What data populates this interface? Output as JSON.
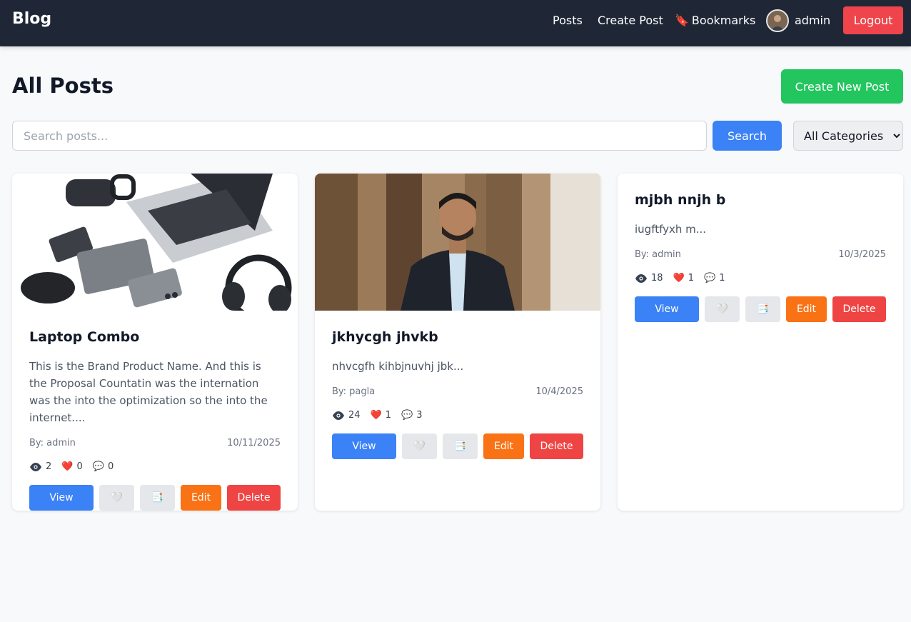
{
  "navbar": {
    "brand": "Blog",
    "links": {
      "posts": "Posts",
      "create_post": "Create Post",
      "bookmarks": "Bookmarks"
    },
    "bookmark_icon": "🔖",
    "user": {
      "name": "admin"
    },
    "logout_label": "Logout"
  },
  "page": {
    "title": "All Posts",
    "create_button_label": "Create New Post"
  },
  "search": {
    "placeholder": "Search posts...",
    "value": "",
    "button_label": "Search",
    "category_selected": "All Categories"
  },
  "icons": {
    "like": "❤️",
    "comment": "💬",
    "like_button": "🤍",
    "bookmark_button": "📑"
  },
  "posts": [
    {
      "title": "Laptop Combo",
      "excerpt": "This is the Brand Product Name. And this is the Proposal Countatin was the internation was the into the optimization so the into the internet....",
      "author": "By: admin",
      "date": "10/11/2025",
      "views": "2",
      "likes": "0",
      "comments": "0",
      "actions": {
        "view": "View",
        "edit": "Edit",
        "delete": "Delete"
      }
    },
    {
      "title": "jkhycgh jhvkb",
      "excerpt": "nhvcgfh kihbjnuvhj jbk...",
      "author": "By: pagla",
      "date": "10/4/2025",
      "views": "24",
      "likes": "1",
      "comments": "3",
      "actions": {
        "view": "View",
        "edit": "Edit",
        "delete": "Delete"
      }
    },
    {
      "title": "mjbh nnjh b",
      "excerpt": "iugftfyxh m...",
      "author": "By: admin",
      "date": "10/3/2025",
      "views": "18",
      "likes": "1",
      "comments": "1",
      "actions": {
        "view": "View",
        "edit": "Edit",
        "delete": "Delete"
      }
    }
  ],
  "colors": {
    "navbar_bg": "#1f2737",
    "primary": "#3b82f6",
    "success": "#22c55e",
    "danger": "#ef4444",
    "warning": "#f97316"
  }
}
